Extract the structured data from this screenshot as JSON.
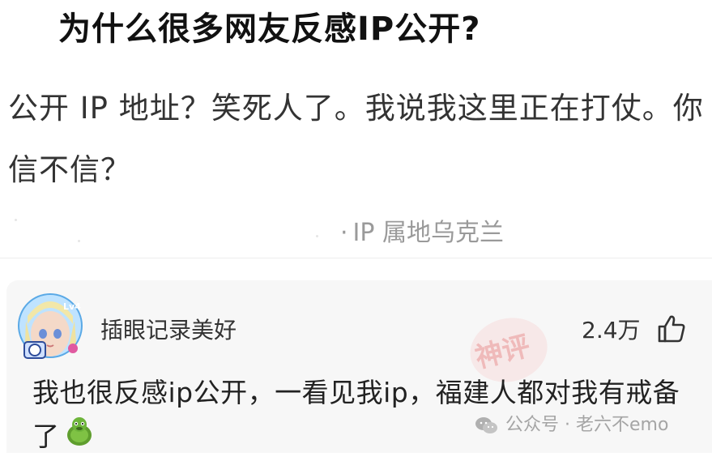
{
  "headline": "为什么很多网友反感IP公开?",
  "post": {
    "text": "公开 IP 地址？笑死人了。我说我这里正在打仗。你信不信？",
    "ip_location": "IP 属地乌克兰"
  },
  "comment": {
    "username": "插眼记录美好",
    "like_count": "2.4万",
    "stamp_text": "神评",
    "text": "我也很反感ip公开，一看见我ip，福建人都对我有戒备了",
    "avatar_badge": "Lv4"
  },
  "watermark": {
    "text": "公众号 · 老六不emo"
  },
  "icons": {
    "like": "thumbs-up-icon",
    "emoji": "turtle-emoji",
    "watermark": "wechat-icon"
  }
}
